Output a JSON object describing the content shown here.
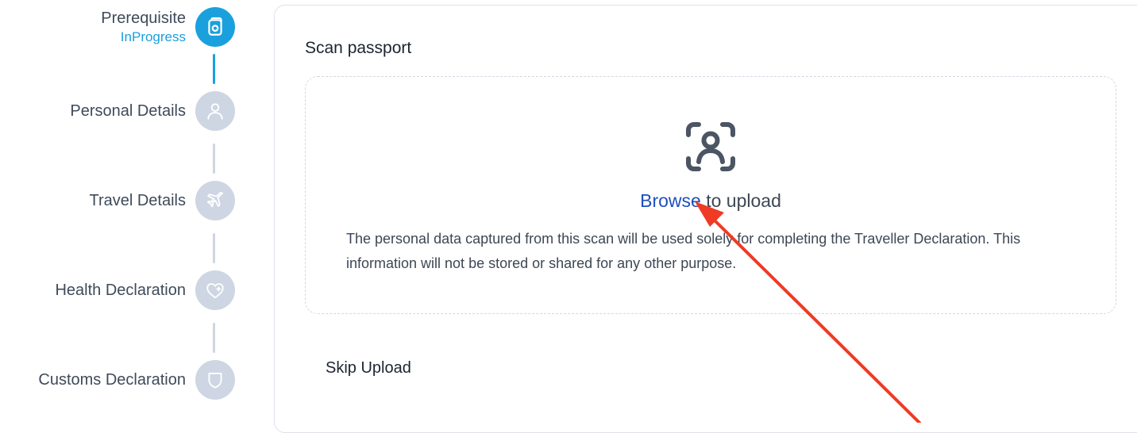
{
  "stepper": {
    "steps": [
      {
        "label": "Prerequisite",
        "status": "InProgress",
        "icon": "camera-doc-icon"
      },
      {
        "label": "Personal Details",
        "icon": "user-icon"
      },
      {
        "label": "Travel Details",
        "icon": "plane-icon"
      },
      {
        "label": "Health Declaration",
        "icon": "heart-plus-icon"
      },
      {
        "label": "Customs Declaration",
        "icon": "shield-icon"
      }
    ],
    "colors": {
      "active": "#1ba0de",
      "inactive": "#cdd6e2"
    }
  },
  "scan": {
    "title": "Scan passport",
    "icon": "face-scan-icon",
    "browse_link": "Browse",
    "browse_suffix": " to upload",
    "disclaimer": "The personal data captured from this scan will be used solely for completing the Traveller Declaration. This information will not be stored or shared for any other purpose."
  },
  "skip_label": "Skip Upload",
  "annotation": {
    "arrow_color": "#f03a24"
  }
}
